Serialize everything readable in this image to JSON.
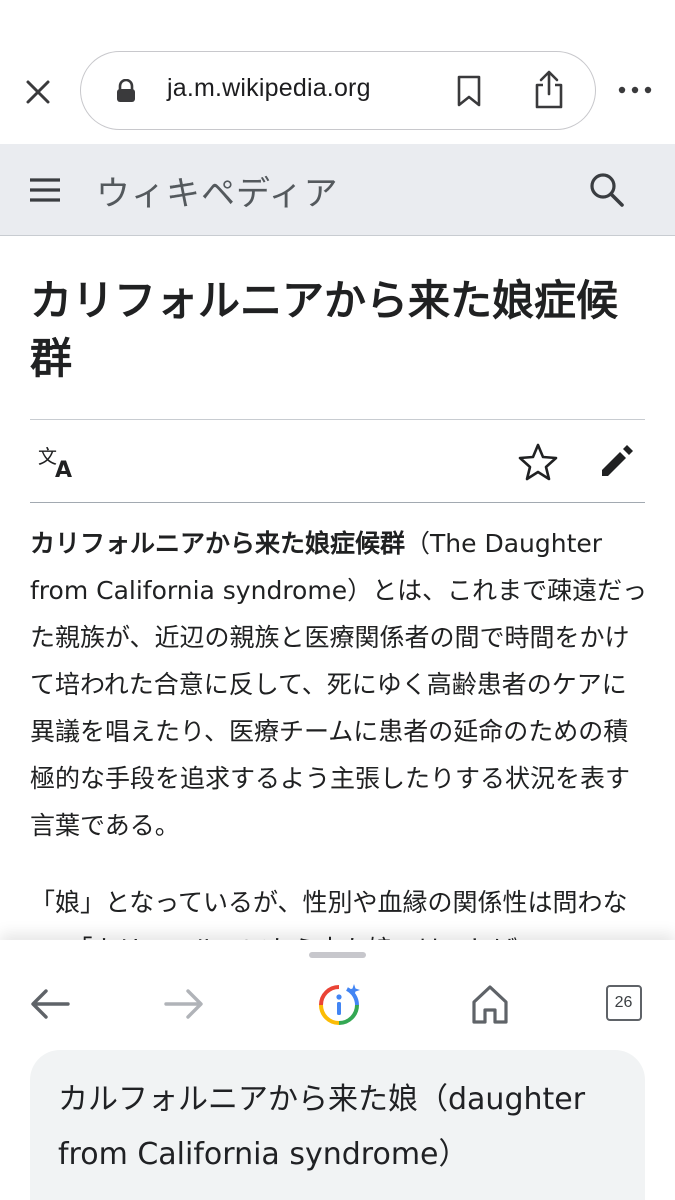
{
  "browser": {
    "url": "ja.m.wikipedia.org",
    "icons": [
      "close-icon",
      "lock-icon",
      "bookmark-icon",
      "share-icon",
      "more-icon"
    ]
  },
  "wiki_header": {
    "logo_text": "ウィキペディア",
    "icons": [
      "hamburger-menu-icon",
      "search-icon"
    ]
  },
  "article": {
    "title": "カリフォルニアから来た娘症候群",
    "action_icons": [
      "language-icon",
      "star-icon",
      "edit-pencil-icon"
    ],
    "lead_bold": "カリフォルニアから来た娘症候群",
    "lead_rest": "（The Daughter from California syndrome）とは、これまで疎遠だった親族が、近辺の親族と医療関係者の間で時間をかけて培われた合意に反して、死にゆく高齢患者のケアに異議を唱えたり、医療チームに患者の延命のための積極的な手段を追求するよう主張したりする状況を表す言葉である。",
    "para2": "「娘」となっているが、性別や血縁の関係性は問わない。「カリフォルニアから来た娘」は、しば"
  },
  "bottom_bar": {
    "icons": [
      "back-arrow-icon",
      "forward-arrow-icon",
      "google-lens-icon",
      "home-icon",
      "tabs-icon"
    ],
    "tab_count": "26",
    "result_text": "カルフォルニアから来た娘（daughter from California syndrome）"
  },
  "colors": {
    "wiki_header_bg": "#eaecf0",
    "forward_disabled": "#b0b3b8",
    "card_bg": "#f1f3f4"
  }
}
